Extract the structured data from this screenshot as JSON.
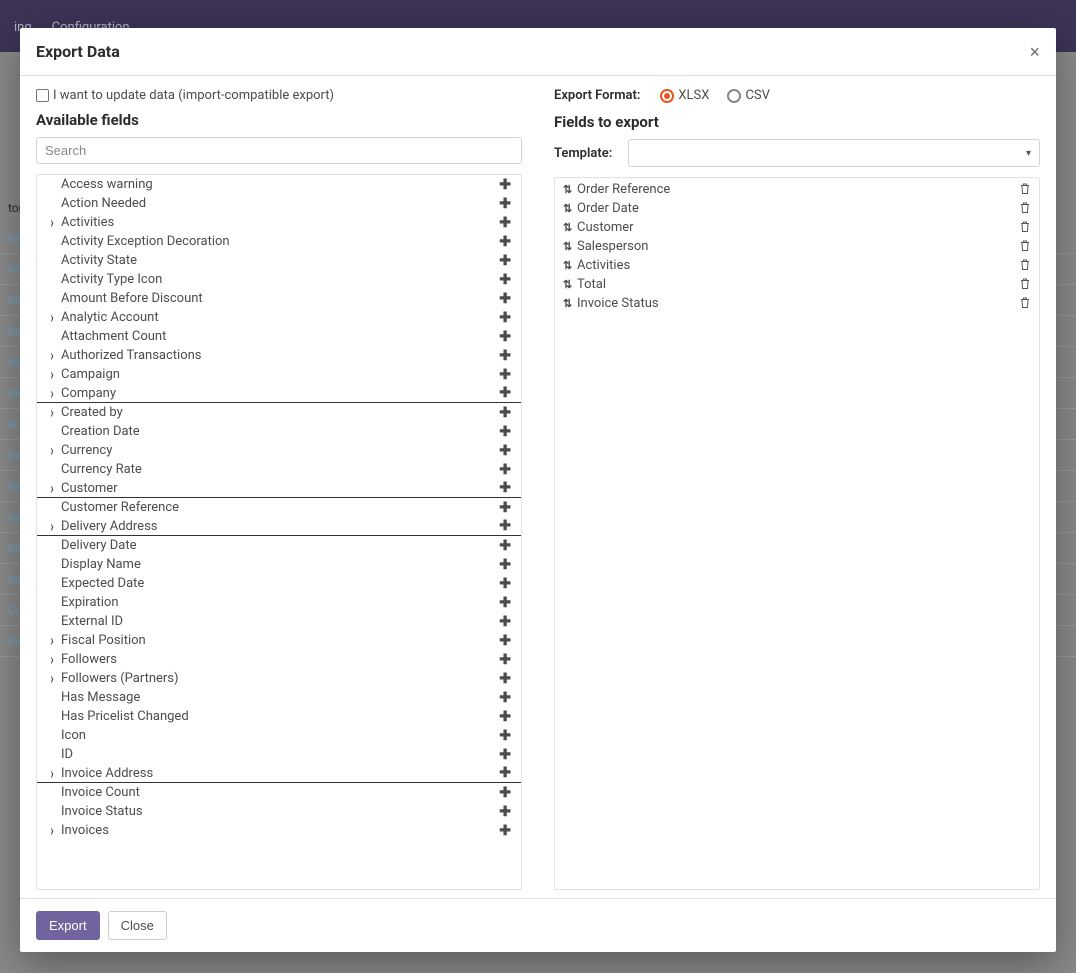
{
  "topbar": {
    "item_left": "ing",
    "item_config": "Configuration"
  },
  "bg_header": "tom",
  "bg_row_labels": [
    "ini",
    "ini",
    "ini",
    "ini",
    "ini",
    "ini",
    "er",
    "ini",
    "ini",
    "ini",
    "ini",
    "ini",
    "Co",
    "ini"
  ],
  "modal": {
    "title": "Export Data",
    "close": "×",
    "compat_label": "I want to update data (import-compatible export)",
    "available_title": "Available fields",
    "search_placeholder": "Search",
    "format_label": "Export Format:",
    "radio_xlsx": "XLSX",
    "radio_csv": "CSV",
    "fields_title": "Fields to export",
    "template_label": "Template:",
    "footer_export": "Export",
    "footer_close": "Close"
  },
  "tree": [
    {
      "label": "Access warning",
      "expandable": false,
      "sep": false
    },
    {
      "label": "Action Needed",
      "expandable": false,
      "sep": false
    },
    {
      "label": "Activities",
      "expandable": true,
      "sep": false
    },
    {
      "label": "Activity Exception Decoration",
      "expandable": false,
      "sep": false
    },
    {
      "label": "Activity State",
      "expandable": false,
      "sep": false
    },
    {
      "label": "Activity Type Icon",
      "expandable": false,
      "sep": false
    },
    {
      "label": "Amount Before Discount",
      "expandable": false,
      "sep": false
    },
    {
      "label": "Analytic Account",
      "expandable": true,
      "sep": false
    },
    {
      "label": "Attachment Count",
      "expandable": false,
      "sep": false
    },
    {
      "label": "Authorized Transactions",
      "expandable": true,
      "sep": false
    },
    {
      "label": "Campaign",
      "expandable": true,
      "sep": false
    },
    {
      "label": "Company",
      "expandable": true,
      "sep": true
    },
    {
      "label": "Created by",
      "expandable": true,
      "sep": false
    },
    {
      "label": "Creation Date",
      "expandable": false,
      "sep": false
    },
    {
      "label": "Currency",
      "expandable": true,
      "sep": false
    },
    {
      "label": "Currency Rate",
      "expandable": false,
      "sep": false
    },
    {
      "label": "Customer",
      "expandable": true,
      "sep": true
    },
    {
      "label": "Customer Reference",
      "expandable": false,
      "sep": false
    },
    {
      "label": "Delivery Address",
      "expandable": true,
      "sep": true
    },
    {
      "label": "Delivery Date",
      "expandable": false,
      "sep": false
    },
    {
      "label": "Display Name",
      "expandable": false,
      "sep": false
    },
    {
      "label": "Expected Date",
      "expandable": false,
      "sep": false
    },
    {
      "label": "Expiration",
      "expandable": false,
      "sep": false
    },
    {
      "label": "External ID",
      "expandable": false,
      "sep": false
    },
    {
      "label": "Fiscal Position",
      "expandable": true,
      "sep": false
    },
    {
      "label": "Followers",
      "expandable": true,
      "sep": false
    },
    {
      "label": "Followers (Partners)",
      "expandable": true,
      "sep": false
    },
    {
      "label": "Has Message",
      "expandable": false,
      "sep": false
    },
    {
      "label": "Has Pricelist Changed",
      "expandable": false,
      "sep": false
    },
    {
      "label": "Icon",
      "expandable": false,
      "sep": false
    },
    {
      "label": "ID",
      "expandable": false,
      "sep": false
    },
    {
      "label": "Invoice Address",
      "expandable": true,
      "sep": true
    },
    {
      "label": "Invoice Count",
      "expandable": false,
      "sep": false
    },
    {
      "label": "Invoice Status",
      "expandable": false,
      "sep": false
    },
    {
      "label": "Invoices",
      "expandable": true,
      "sep": false
    }
  ],
  "export_fields": [
    {
      "label": "Order Reference"
    },
    {
      "label": "Order Date"
    },
    {
      "label": "Customer"
    },
    {
      "label": "Salesperson"
    },
    {
      "label": "Activities"
    },
    {
      "label": "Total"
    },
    {
      "label": "Invoice Status"
    }
  ]
}
